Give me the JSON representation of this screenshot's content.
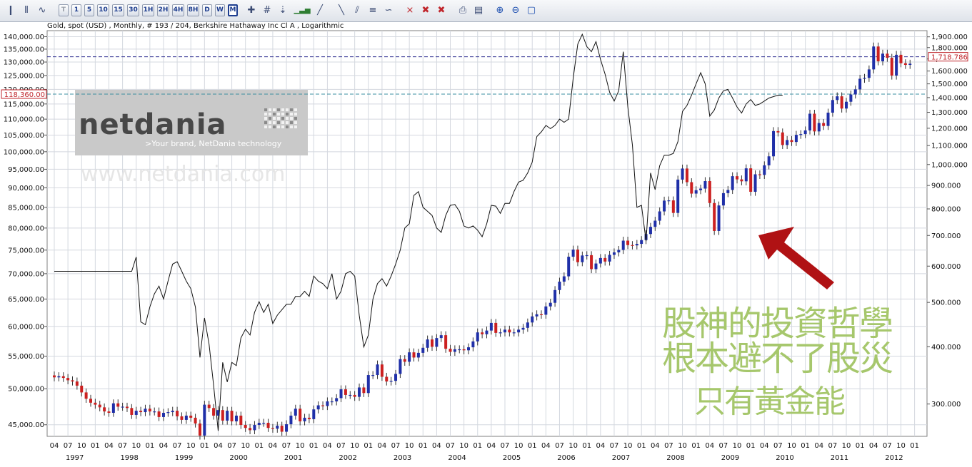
{
  "toolbar": {
    "periods": [
      "T",
      "1",
      "5",
      "10",
      "15",
      "30",
      "1H",
      "2H",
      "4H",
      "8H",
      "D",
      "W",
      "M"
    ],
    "active_period": "M",
    "icons": [
      "candlestick-chart-icon",
      "bar-chart-icon",
      "line-chart-icon",
      "crosshair-icon",
      "hash-grid-icon",
      "arrow-down-icon",
      "indicator-bars-icon",
      "draw-line-tool-icon",
      "draw-fan-tool-icon",
      "draw-channel-tool-icon",
      "draw-fib-tool-icon",
      "draw-cycle-tool-icon",
      "delete-tool-icon",
      "delete-icon",
      "delete-all-icon",
      "print-icon",
      "print-preview-icon",
      "zoom-in-icon",
      "zoom-out-icon",
      "zoom-reset-icon"
    ],
    "colors": {
      "text": "#1d3d8f",
      "background": "#e6eaf0"
    }
  },
  "chart_info": "Gold, spot (USD) , Monthly, # 193 / 204, Berkshire Hathaway Inc Cl A , Logarithmic",
  "watermark": {
    "brand": "netdania",
    "tagline": ">Your brand, NetDania technology",
    "url": "www.netdania.com"
  },
  "annotation": {
    "lines": [
      "股神的投資哲學",
      "根本避不了股災",
      "只有黃金能"
    ],
    "color": "#a6c76c",
    "arrow_color": "#b01214"
  },
  "chart_data": {
    "type": "line",
    "y_scale": "log",
    "x_range": [
      "1997-04",
      "2012-05"
    ],
    "x_ticks": {
      "months": [
        "04",
        "07",
        "10",
        "01",
        "04",
        "07",
        "10",
        "01",
        "04",
        "07",
        "10",
        "01",
        "04",
        "07",
        "10",
        "01",
        "04",
        "07",
        "10",
        "01",
        "04",
        "07",
        "10",
        "01",
        "04",
        "07",
        "10",
        "01",
        "04",
        "07",
        "10",
        "01",
        "04",
        "07",
        "10",
        "01",
        "04",
        "07",
        "10",
        "01",
        "04",
        "07",
        "10",
        "01",
        "04",
        "07",
        "10",
        "01",
        "04",
        "07",
        "10",
        "01",
        "04",
        "07",
        "10",
        "01",
        "04",
        "07",
        "10",
        "01",
        "04",
        "07",
        "10",
        "01"
      ],
      "years": [
        "1997",
        "1998",
        "1999",
        "2000",
        "2001",
        "2002",
        "2003",
        "2004",
        "2005",
        "2006",
        "2007",
        "2008",
        "2009",
        "2010",
        "2011",
        "2012"
      ]
    },
    "left_axis": {
      "series": "Berkshire Hathaway Inc Cl A",
      "ylim": [
        43500,
        142500
      ],
      "ticks": [
        "140,000.00",
        "135,000.00",
        "130,000.00",
        "125,000.00",
        "120,000.00",
        "115,000.00",
        "110,000.00",
        "105,000.00",
        "100,000.00",
        "95,000.00",
        "90,000.00",
        "85,000.00",
        "80,000.00",
        "75,000.00",
        "70,000.00",
        "65,000.00",
        "60,000.00",
        "55,000.00",
        "50,000.00",
        "45,000.00"
      ],
      "tick_values": [
        140000,
        135000,
        130000,
        125000,
        120000,
        115000,
        110000,
        105000,
        100000,
        95000,
        90000,
        85000,
        80000,
        75000,
        70000,
        65000,
        60000,
        55000,
        50000,
        45000
      ],
      "marker": {
        "label": "118,360.00",
        "value": 118360,
        "color": "#c0262c"
      }
    },
    "right_axis": {
      "series": "Gold, spot (USD)",
      "ylim": [
        255,
        1960
      ],
      "ticks": [
        "1,900.000",
        "1,800.000",
        "1,700.000",
        "1,600.000",
        "1,500.000",
        "1,400.000",
        "1,300.000",
        "1,200.000",
        "1,100.000",
        "1,000.000",
        "900.000",
        "800.000",
        "700.000",
        "600.000",
        "500.000",
        "400.000",
        "300.000"
      ],
      "tick_values": [
        1900,
        1800,
        1700,
        1600,
        1500,
        1400,
        1300,
        1200,
        1100,
        1000,
        900,
        800,
        700,
        600,
        500,
        400,
        300
      ],
      "marker": {
        "label": "1,718.786",
        "value": 1718.786,
        "color": "#c0262c"
      }
    },
    "gold_candles_monthly_close": [
      343,
      345,
      342,
      338,
      336,
      329,
      318,
      308,
      302,
      299,
      295,
      289,
      287,
      301,
      296,
      296,
      294,
      284,
      290,
      288,
      293,
      289,
      289,
      281,
      287,
      288,
      290,
      282,
      277,
      283,
      280,
      272,
      256,
      299,
      294,
      283,
      291,
      276,
      290,
      275,
      283,
      270,
      266,
      263,
      270,
      273,
      273,
      266,
      265,
      269,
      261,
      271,
      283,
      293,
      275,
      280,
      278,
      292,
      298,
      297,
      304,
      304,
      309,
      323,
      314,
      314,
      311,
      326,
      317,
      347,
      347,
      366,
      344,
      336,
      337,
      349,
      376,
      371,
      389,
      379,
      388,
      398,
      415,
      400,
      418,
      424,
      396,
      390,
      395,
      395,
      393,
      399,
      411,
      430,
      426,
      434,
      451,
      429,
      430,
      436,
      430,
      430,
      436,
      440,
      452,
      466,
      471,
      470,
      490,
      499,
      532,
      555,
      570,
      629,
      652,
      612,
      633,
      634,
      591,
      608,
      625,
      614,
      635,
      643,
      651,
      682,
      667,
      666,
      671,
      684,
      705,
      731,
      754,
      790,
      834,
      835,
      784,
      927,
      980,
      915,
      864,
      879,
      886,
      920,
      824,
      716,
      814,
      866,
      880,
      943,
      928,
      919,
      981,
      872,
      952,
      949,
      996,
      1042,
      1183,
      1175,
      1103,
      1131,
      1120,
      1161,
      1165,
      1187,
      1291,
      1181,
      1232,
      1214,
      1298,
      1383,
      1409,
      1325,
      1371,
      1422,
      1459,
      1539,
      1546,
      1613,
      1810,
      1680,
      1746,
      1710,
      1564,
      1736,
      1664,
      1650,
      1660
    ],
    "berkshire_monthly_close": [
      70500,
      70500,
      70500,
      70500,
      70500,
      70500,
      70500,
      70500,
      70500,
      70500,
      70500,
      70500,
      70500,
      70500,
      70500,
      70500,
      70500,
      70500,
      73500,
      60800,
      60300,
      63500,
      66000,
      67500,
      65000,
      68500,
      72000,
      72500,
      70500,
      68500,
      67000,
      63500,
      54800,
      61500,
      57000,
      50500,
      44200,
      54000,
      51000,
      54000,
      53500,
      58000,
      59500,
      58500,
      62500,
      64500,
      62500,
      64000,
      60500,
      62000,
      63000,
      64000,
      64000,
      65500,
      65500,
      66500,
      65500,
      69500,
      68500,
      68000,
      67000,
      70000,
      65000,
      66500,
      70000,
      70500,
      69500,
      62000,
      56500,
      58500,
      65000,
      68000,
      69000,
      67500,
      69500,
      72000,
      75000,
      80000,
      81000,
      88000,
      89000,
      85000,
      84000,
      83000,
      80000,
      79000,
      83000,
      85500,
      85700,
      84000,
      80500,
      80000,
      80500,
      79500,
      78000,
      81000,
      85500,
      85300,
      83500,
      86000,
      86000,
      89000,
      91500,
      92000,
      94000,
      97000,
      104500,
      106000,
      108000,
      107000,
      108000,
      110000,
      109000,
      110000,
      124000,
      137000,
      141000,
      136000,
      134000,
      138000,
      131000,
      125500,
      119000,
      116000,
      119500,
      134000,
      114000,
      102000,
      85000,
      85500,
      77000,
      94000,
      89500,
      96000,
      99000,
      99000,
      99500,
      103000,
      112500,
      114500,
      118000,
      122000,
      126000,
      122000,
      111000,
      113000,
      117000,
      119500,
      120000,
      117000,
      114000,
      112000,
      115000,
      116500,
      114500,
      115000,
      116000,
      117000,
      117500,
      118000,
      118000
    ],
    "overlays": [
      {
        "type": "hline",
        "axis": "left",
        "value": 118360,
        "color": "#3a8fa0",
        "style": "dashed"
      },
      {
        "type": "hline",
        "axis": "right",
        "value": 1718.786,
        "color": "#2b2b8f",
        "style": "dashed"
      }
    ],
    "legend": "none",
    "grid": true
  }
}
